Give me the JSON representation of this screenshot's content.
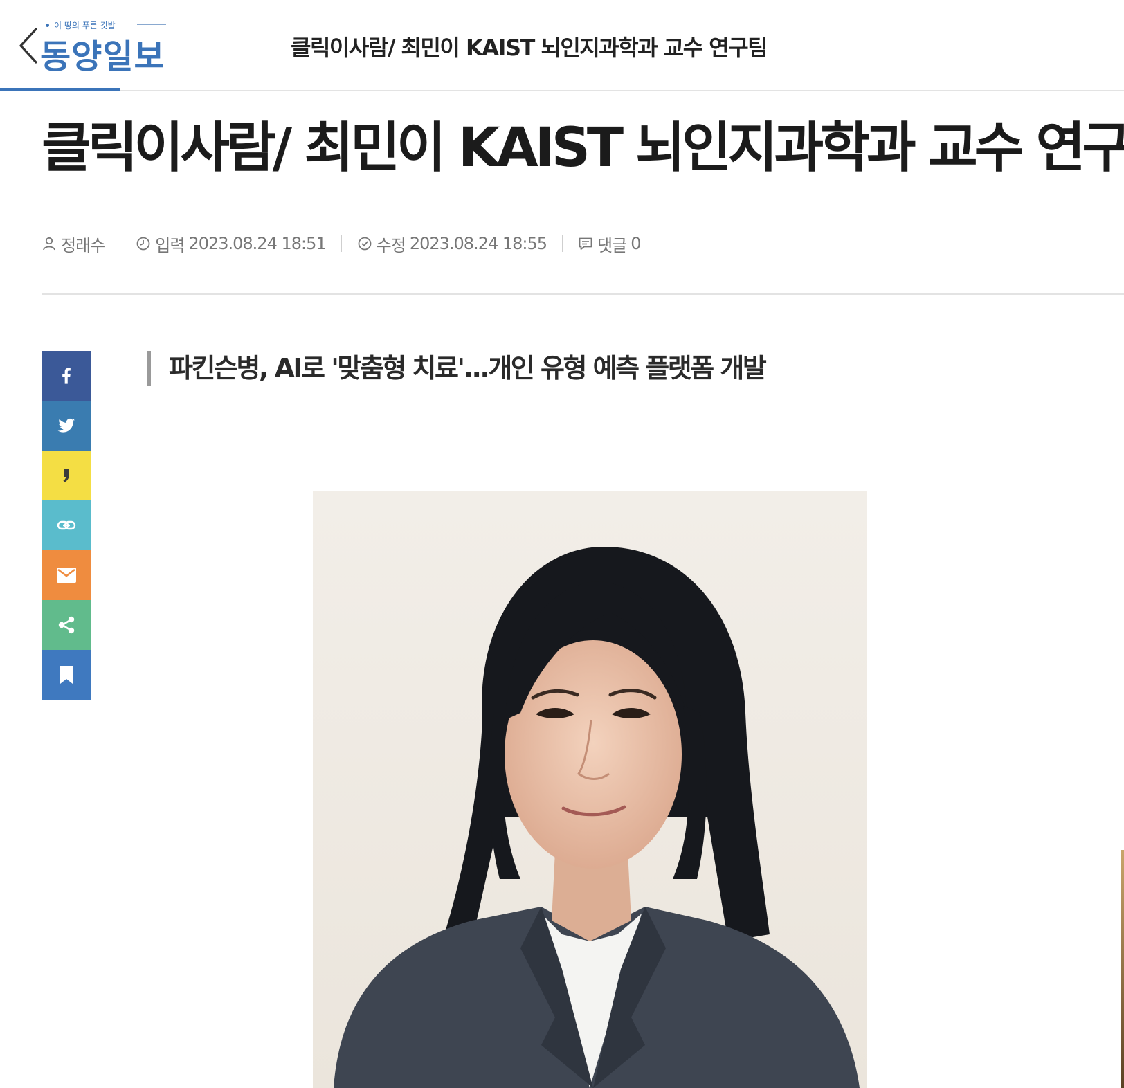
{
  "header": {
    "logo_slogan": "이 땅의 푸른 깃발",
    "logo_name": "동양일보",
    "title": "클릭이사람/ 최민이 KAIST 뇌인지과학과 교수 연구팀"
  },
  "article": {
    "headline": "클릭이사람/ 최민이 KAIST 뇌인지과학과 교수 연구팀",
    "subtitle": "파킨슨병, AI로 '맞춤형 치료'...개인 유형 예측 플랫폼 개발",
    "meta": {
      "author": "정래수",
      "input_label": "입력",
      "input_date": "2023.08.24 18:51",
      "modified_label": "수정",
      "modified_date": "2023.08.24 18:55",
      "comments_label": "댓글",
      "comments_count": "0"
    }
  },
  "share": {
    "buttons": [
      {
        "name": "facebook",
        "icon": "facebook-icon",
        "color": "#3b5998"
      },
      {
        "name": "twitter",
        "icon": "twitter-icon",
        "color": "#3a7cb0"
      },
      {
        "name": "kakaostory",
        "icon": "kakaostory-icon",
        "color": "#f4de44"
      },
      {
        "name": "copy-link",
        "icon": "link-icon",
        "color": "#5abccc"
      },
      {
        "name": "email",
        "icon": "mail-icon",
        "color": "#ef8c3f"
      },
      {
        "name": "more-share",
        "icon": "share-icon",
        "color": "#61bb8c"
      },
      {
        "name": "bookmark",
        "icon": "bookmark-icon",
        "color": "#3f79bf"
      }
    ]
  },
  "colors": {
    "brand": "#3b74b9",
    "divider": "#e3e3e3",
    "meta_text": "#777777"
  }
}
